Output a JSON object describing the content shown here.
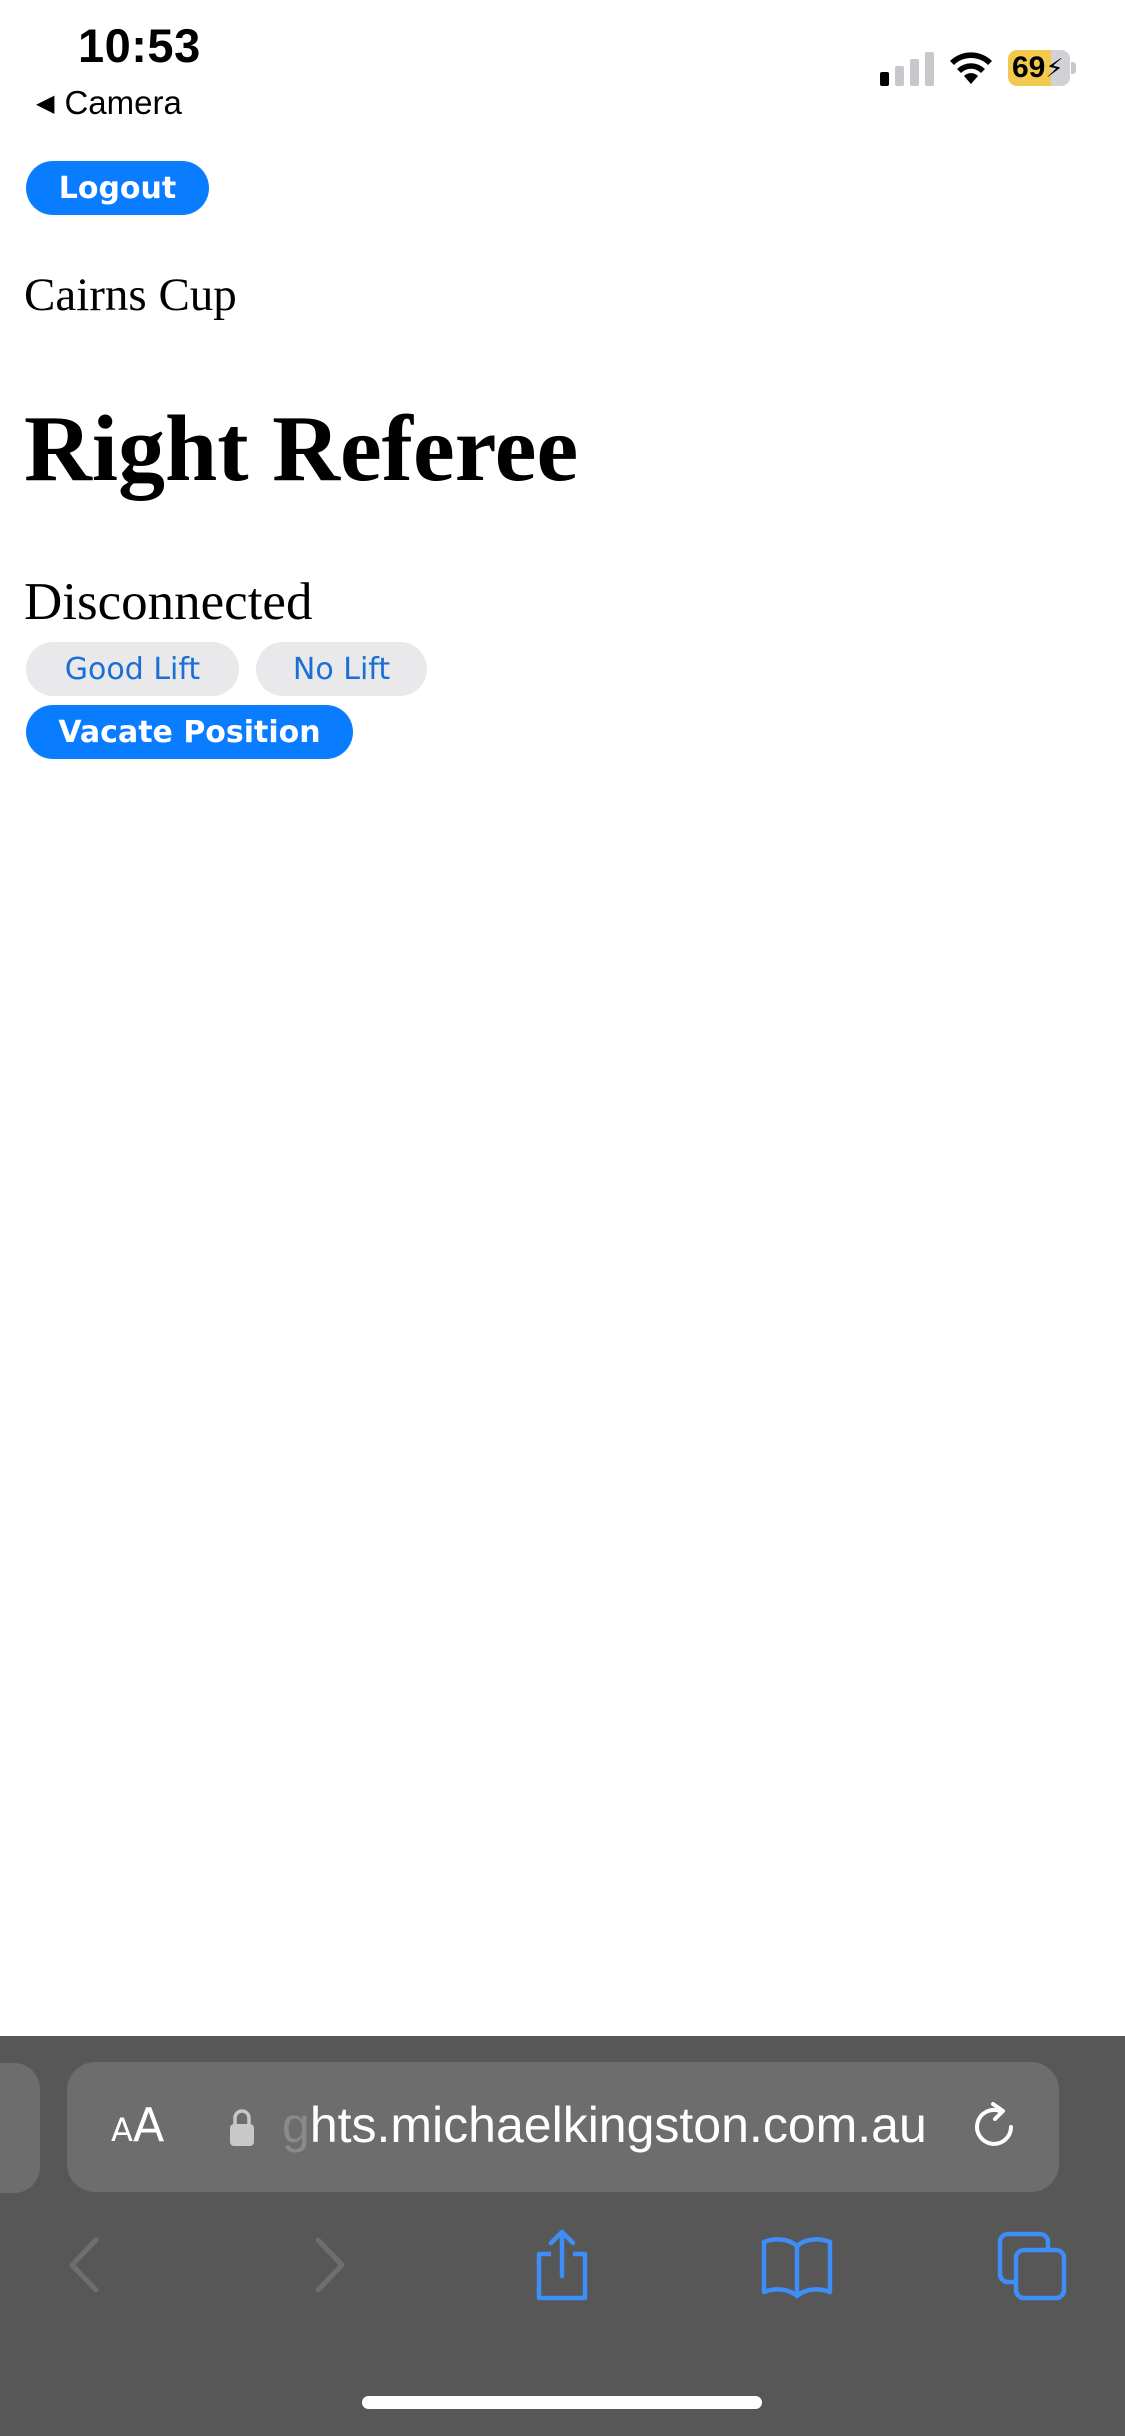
{
  "status_bar": {
    "time": "10:53",
    "back_app": "Camera",
    "battery_percent": "69",
    "battery_level": 0.69,
    "signal_bars_active": 1,
    "signal_bars_total": 4
  },
  "page": {
    "logout_label": "Logout",
    "competition_name": "Cairns Cup",
    "role_heading": "Right Referee",
    "connection_status": "Disconnected",
    "good_lift_label": "Good Lift",
    "no_lift_label": "No Lift",
    "vacate_label": "Vacate Position"
  },
  "browser": {
    "text_size_small": "A",
    "text_size_big": "A",
    "url_faded_prefix": "g",
    "url_visible": "hts.michaelkingston.com.au"
  },
  "colors": {
    "primary_button": "#0a7cff",
    "secondary_button_bg": "#e9e9eb",
    "secondary_button_text": "#1a6fd6",
    "toolbar_bg": "#575757",
    "toolbar_icon": "#3e8ef7",
    "battery_fill": "#f2c94c"
  },
  "icons": {
    "back_app": "back-triangle-icon",
    "wifi": "wifi-icon",
    "battery": "battery-charging-icon",
    "lock": "lock-icon",
    "reload": "reload-icon",
    "nav_back": "chevron-left-icon",
    "nav_forward": "chevron-right-icon",
    "share": "share-icon",
    "bookmarks": "book-icon",
    "tabs": "tabs-icon"
  }
}
